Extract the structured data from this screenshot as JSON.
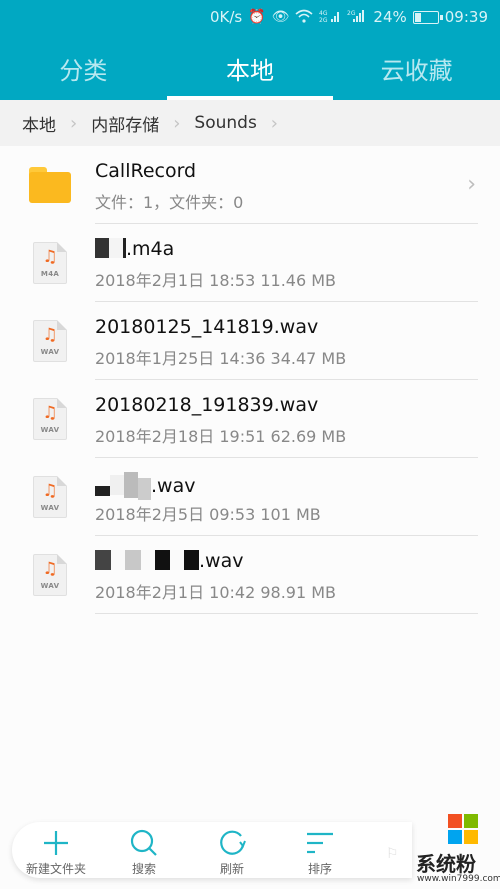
{
  "status_bar": {
    "net_speed": "0K/s",
    "alarm_icon": "alarm-icon",
    "eye_icon": "eye-comfort-icon",
    "wifi_icon": "wifi-icon",
    "signal1_label": "4G 2G",
    "signal2_label": "2G",
    "battery_percent": "24%",
    "battery_level": 0.24,
    "time": "09:39"
  },
  "tabs": [
    {
      "label": "分类",
      "active": false
    },
    {
      "label": "本地",
      "active": true
    },
    {
      "label": "云收藏",
      "active": false
    }
  ],
  "breadcrumb": [
    "本地",
    "内部存储",
    "Sounds"
  ],
  "list": [
    {
      "type": "folder",
      "name": "CallRecord",
      "meta": "文件：1，文件夹：0"
    },
    {
      "type": "file",
      "ext": "M4A",
      "name_visible": ".m4a",
      "meta": "2018年2月1日 18:53 11.46 MB"
    },
    {
      "type": "file",
      "ext": "WAV",
      "name_visible": "20180125_141819.wav",
      "meta": "2018年1月25日 14:36 34.47 MB"
    },
    {
      "type": "file",
      "ext": "WAV",
      "name_visible": "20180218_191839.wav",
      "meta": "2018年2月18日 19:51 62.69 MB"
    },
    {
      "type": "file",
      "ext": "WAV",
      "name_visible": ".wav",
      "meta": "2018年2月5日 09:53 101 MB"
    },
    {
      "type": "file",
      "ext": "WAV",
      "name_visible": ".wav",
      "meta": "2018年2月1日 10:42 98.91 MB"
    }
  ],
  "bottom_bar": [
    {
      "label": "新建文件夹",
      "icon": "plus-icon"
    },
    {
      "label": "搜索",
      "icon": "search-icon"
    },
    {
      "label": "刷新",
      "icon": "refresh-icon"
    },
    {
      "label": "排序",
      "icon": "sort-icon"
    }
  ],
  "watermark": {
    "text": "系统粉",
    "url": "www.win7999.com"
  },
  "colors": {
    "accent": "#01a8c2",
    "icon_teal": "#1fb5c6",
    "folder": "#fbb91f",
    "music_note": "#f06a23"
  }
}
